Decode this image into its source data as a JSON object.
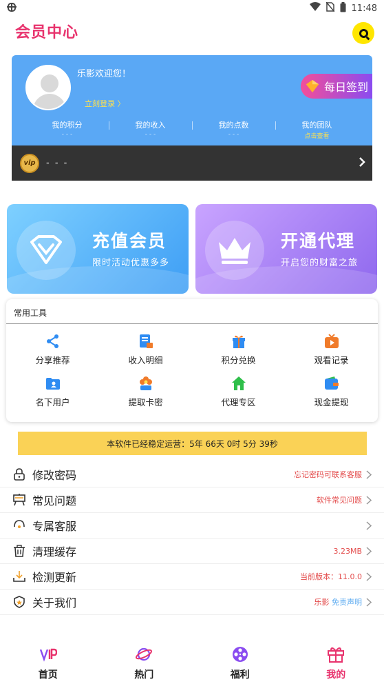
{
  "status_bar": {
    "time": "11:48",
    "left_icon": "bug-icon"
  },
  "header": {
    "title": "会员中心",
    "logo": "q-logo"
  },
  "profile": {
    "welcome": "乐影欢迎您！",
    "login_link": "立刻登录 〉",
    "signin_button": "每日签到",
    "stats": [
      {
        "label": "我的积分",
        "value": "- - -"
      },
      {
        "label": "我的收入",
        "value": "- - -"
      },
      {
        "label": "我的点数",
        "value": "- - -"
      },
      {
        "label": "我的团队",
        "value": "点击查看"
      }
    ],
    "vip": {
      "badge": "vip",
      "text": "- - -"
    }
  },
  "promos": [
    {
      "title": "充值会员",
      "subtitle": "限时活动优惠多多"
    },
    {
      "title": "开通代理",
      "subtitle": "开启您的财富之旅"
    }
  ],
  "tools": {
    "title": "常用工具",
    "items": [
      {
        "label": "分享推荐",
        "icon": "share-icon",
        "color": "#2f8cf2"
      },
      {
        "label": "收入明细",
        "icon": "receipt-icon",
        "color": "#2f8cf2"
      },
      {
        "label": "积分兑换",
        "icon": "gift-box-icon",
        "color": "#2f8cf2"
      },
      {
        "label": "观看记录",
        "icon": "play-tv-icon",
        "color": "#f07b2a"
      },
      {
        "label": "名下用户",
        "icon": "user-folder-icon",
        "color": "#2f8cf2"
      },
      {
        "label": "提取卡密",
        "icon": "flower-icon",
        "color": "#f07b2a"
      },
      {
        "label": "代理专区",
        "icon": "home-icon",
        "color": "#2fbf4a"
      },
      {
        "label": "现金提现",
        "icon": "wallet-icon",
        "color": "#2f8cf2"
      }
    ]
  },
  "runtime": "本软件已经稳定运营：5年 66天 0时 5分 39秒",
  "menu": [
    {
      "label": "修改密码",
      "right": "忘记密码可联系客服",
      "icon": "lock-icon"
    },
    {
      "label": "常见问题",
      "right": "软件常见问题",
      "icon": "board-icon"
    },
    {
      "label": "专属客服",
      "right": "",
      "icon": "headset-icon"
    },
    {
      "label": "清理缓存",
      "right": "3.23MB",
      "icon": "trash-icon"
    },
    {
      "label": "检测更新",
      "right": "当前版本：11.0.0",
      "icon": "download-icon"
    },
    {
      "label": "关于我们",
      "right": "乐影",
      "right_extra": "免责声明",
      "icon": "shield-icon"
    }
  ],
  "tabs": [
    {
      "label": "首页",
      "icon": "vip-logo-icon",
      "active": false
    },
    {
      "label": "热门",
      "icon": "planet-icon",
      "active": false
    },
    {
      "label": "福利",
      "icon": "film-reel-icon",
      "active": false
    },
    {
      "label": "我的",
      "icon": "gift-icon",
      "active": true
    }
  ],
  "colors": {
    "accent": "#e8336d",
    "card_blue": "#5aa8f5",
    "runtime_bg": "#fad256"
  }
}
